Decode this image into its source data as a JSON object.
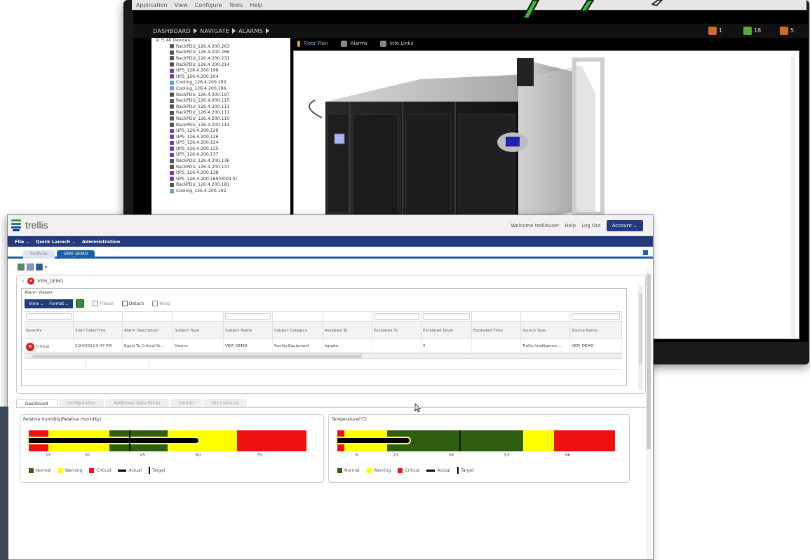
{
  "back_window": {
    "menu": [
      "Application",
      "View",
      "Configure",
      "Tools",
      "Help"
    ],
    "breadcrumb": [
      "DASHBOARD",
      "NAVIGATE",
      "ALARMS"
    ],
    "badges": [
      {
        "count": "1",
        "color": "#d06a2a"
      },
      {
        "count": "18",
        "color": "#5aa83a"
      },
      {
        "count": "5",
        "color": "#d06a2a"
      }
    ],
    "tree_root": "All Devices",
    "tree_items": [
      "RackPDU_126.4.200.263",
      "RackPDU_126.4.200.266",
      "RackPDU_126.4.200.231",
      "RackPDU_126.4.200.214",
      "UPS_126.4.200.198",
      "UPS_126.4.200.104",
      "Cooling_126.4.200.193",
      "Cooling_126.4.200.196",
      "RackPDU_126.4.200.197",
      "RackPDU_126.4.200.115",
      "RackPDU_126.4.200.113",
      "RackPDU_126.4.200.111",
      "RackPDU_126.4.200.110",
      "RackPDU_126.4.200.114",
      "UPS_126.4.200.129",
      "UPS_126.4.200.126",
      "UPS_126.4.200.124",
      "UPS_126.4.200.125",
      "UPS_126.4.200.137",
      "RackPDU_126.4.200.136",
      "RackPDU_126.4.200.137",
      "UPS_126.4.200.138",
      "UPS_126.4.200.169(0003.0)",
      "RackPDU_126.4.200.181",
      "Cooling_126.4.200.192"
    ],
    "tabs": [
      "Floor Plan",
      "Alarms",
      "Info Links"
    ]
  },
  "app": {
    "logo_text": "trellis",
    "welcome": "Welcome trellisuser",
    "help": "Help",
    "logout": "Log Out",
    "account": "Account ⌄",
    "menu": [
      "File ⌄",
      "Quick Launch ⌄",
      "Administration"
    ],
    "tabs": [
      "Portfolio",
      "VEM_DEMO"
    ]
  },
  "panel": {
    "title": "VEM_DEMO",
    "alarm_viewer_title": "Alarm Viewer",
    "view_btn": "View ⌄",
    "format_btn": "Format ⌄",
    "tools": [
      "Freeze",
      "Detach",
      "Wrap"
    ],
    "columns": [
      "Severity",
      "Start Date/Time",
      "Alarm Description",
      "Subject Type",
      "Subject Name",
      "Subject Category",
      "Assigned To",
      "Escalated To",
      "Escalated Level",
      "Escalated Time",
      "Source Type",
      "Source Name"
    ],
    "filter_boxes": [
      true,
      false,
      false,
      false,
      true,
      false,
      false,
      true,
      true,
      false,
      false,
      true
    ],
    "row": {
      "severity": "Critical",
      "start": "5/24/2013 9:47 PM",
      "description": "Equal To Critical St...",
      "subject_type": "Device",
      "subject_name": "VEM_DEMO",
      "subject_category": "Facility.Equipment",
      "assigned_to": "kgupta",
      "escalated_to": "",
      "escalated_level": "0",
      "escalated_time": "",
      "source_type": "Trellis Intelligence ...",
      "source_name": "VEM_DEMO"
    }
  },
  "subtabs": [
    "Dashboard",
    "Configuration",
    "Additional Data Points",
    "Control",
    "Div Contacts"
  ],
  "gauges": [
    {
      "title": "Relative Humidity(Relative Humidity)",
      "bands": [
        {
          "from": 0,
          "to": 0.07,
          "color": "#ee1111"
        },
        {
          "from": 0.07,
          "to": 0.29,
          "color": "#ffff00"
        },
        {
          "from": 0.29,
          "to": 0.5,
          "color": "#2e5e0e"
        },
        {
          "from": 0.5,
          "to": 0.75,
          "color": "#ffff00"
        },
        {
          "from": 0.75,
          "to": 1.0,
          "color": "#ee1111"
        }
      ],
      "actual": 0.61,
      "target": 0.36,
      "ticks": [
        {
          "label": "15",
          "pos": 0.07
        },
        {
          "label": "30",
          "pos": 0.21
        },
        {
          "label": "45",
          "pos": 0.41
        },
        {
          "label": "60",
          "pos": 0.61
        },
        {
          "label": "75",
          "pos": 0.83
        }
      ]
    },
    {
      "title": "Temperature(°C)",
      "bands": [
        {
          "from": 0,
          "to": 0.025,
          "color": "#ee1111"
        },
        {
          "from": 0.025,
          "to": 0.18,
          "color": "#ffff00"
        },
        {
          "from": 0.18,
          "to": 0.67,
          "color": "#2e5e0e"
        },
        {
          "from": 0.67,
          "to": 0.78,
          "color": "#ffff00"
        },
        {
          "from": 0.78,
          "to": 1.0,
          "color": "#ee1111"
        }
      ],
      "actual": 0.26,
      "target": 0.44,
      "ticks": [
        {
          "label": "6",
          "pos": 0.07
        },
        {
          "label": "23",
          "pos": 0.21
        },
        {
          "label": "36",
          "pos": 0.41
        },
        {
          "label": "53",
          "pos": 0.61
        },
        {
          "label": "66",
          "pos": 0.83
        }
      ]
    }
  ],
  "legend": {
    "normal": "Normal",
    "warning": "Warning",
    "critical": "Critical",
    "actual": "Actual",
    "target": "Target"
  },
  "colors": {
    "navy": "#243a7a",
    "tab_blue": "#1a5faa",
    "critical": "#d32020",
    "normal": "#2e5e0e",
    "warning": "#ffff00"
  }
}
